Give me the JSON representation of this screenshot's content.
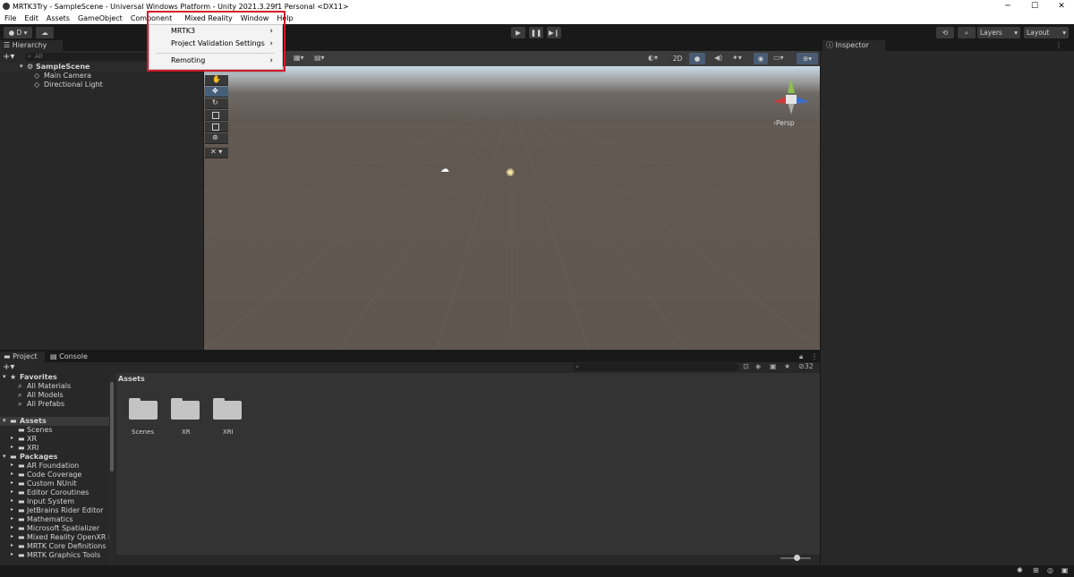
{
  "window": {
    "title": "MRTK3Try - SampleScene - Universal Windows Platform - Unity 2021.3.29f1 Personal <DX11>",
    "minimize": "─",
    "maximize": "☐",
    "close": "✕"
  },
  "menubar": [
    "File",
    "Edit",
    "Assets",
    "GameObject",
    "Component",
    "Mixed Reality",
    "Window",
    "Help"
  ],
  "dropdown": {
    "items": [
      "MRTK3",
      "Project Validation Settings",
      "Remoting"
    ],
    "arrow": "›"
  },
  "toolbar": {
    "account_label": "D",
    "layers_label": "Layers",
    "layout_label": "Layout"
  },
  "hierarchy": {
    "tab_label": "Hierarchy",
    "search_placeholder": "All",
    "scene_name": "SampleScene",
    "objects": [
      "Main Camera",
      "Directional Light"
    ]
  },
  "scene_view": {
    "toggle_2d": "2D",
    "persp_label": "Persp"
  },
  "inspector": {
    "tab_label": "Inspector"
  },
  "project": {
    "tab_label": "Project",
    "console_tab_label": "Console",
    "breadcrumb": "Assets",
    "hidden_count": "32",
    "favorites_label": "Favorites",
    "favorites": [
      "All Materials",
      "All Models",
      "All Prefabs"
    ],
    "assets_label": "Assets",
    "assets_tree": [
      "Scenes",
      "XR",
      "XRI"
    ],
    "packages_label": "Packages",
    "packages": [
      "AR Foundation",
      "Code Coverage",
      "Custom NUnit",
      "Editor Coroutines",
      "Input System",
      "JetBrains Rider Editor",
      "Mathematics",
      "Microsoft Spatializer",
      "Mixed Reality OpenXR Plu",
      "MRTK Core Definitions",
      "MRTK Graphics Tools"
    ],
    "folders": [
      "Scenes",
      "XR",
      "XRI"
    ]
  }
}
